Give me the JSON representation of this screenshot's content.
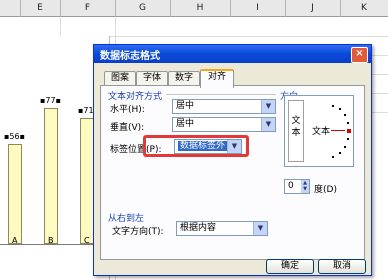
{
  "sheet": {
    "columns": [
      "E",
      "F",
      "G",
      "H",
      "I",
      "J",
      "K"
    ],
    "chart": {
      "categories": [
        "A",
        "B",
        "C"
      ],
      "data_labels": [
        "56",
        "77",
        "71"
      ]
    }
  },
  "dialog": {
    "title": "数据标志格式",
    "close_glyph": "×",
    "tabs": [
      "图案",
      "字体",
      "数字",
      "对齐"
    ],
    "text_alignment_group": "文本对齐方式",
    "horizontal_label": "水平(H):",
    "horizontal_value": "居中",
    "vertical_label": "垂直(V):",
    "vertical_value": "居中",
    "label_position_label": "标签位置(P):",
    "label_position_value": "数据标签外",
    "orientation_group": "方向",
    "vertical_text": "文本",
    "dial_text": "文本",
    "degrees_value": "0",
    "degrees_label": "度(D)",
    "rtl_group": "从右到左",
    "text_direction_label": "文字方向(T):",
    "text_direction_value": "根据内容",
    "ok_label": "确定",
    "cancel_label": "取消"
  }
}
